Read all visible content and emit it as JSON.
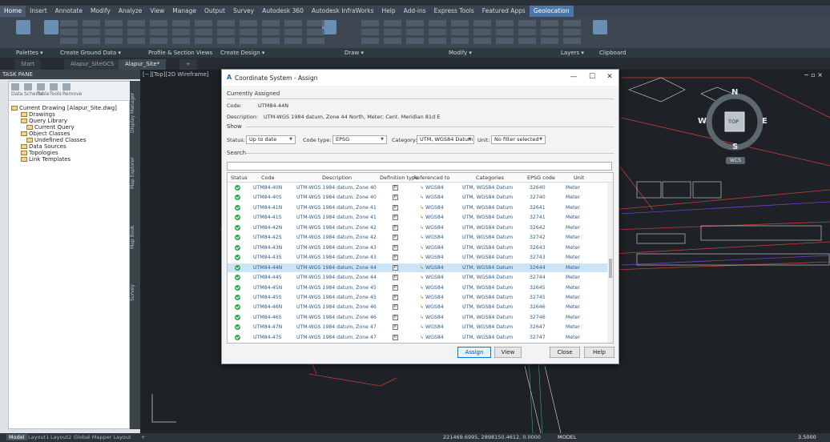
{
  "ribbon": {
    "tabs": [
      "Home",
      "Insert",
      "Annotate",
      "Modify",
      "Analyze",
      "View",
      "Manage",
      "Output",
      "Survey",
      "Autodesk 360",
      "Autodesk InfraWorks",
      "Help",
      "Add-ins",
      "Express Tools",
      "Featured Apps",
      "Geolocation"
    ],
    "active_tab": "Home",
    "panels": [
      "Palettes ▾",
      "Create Ground Data ▾",
      "Profile & Section Views",
      "Create Design ▾",
      "Draw ▾",
      "Modify ▾",
      "Layers ▾",
      "Clipboard"
    ]
  },
  "doc_tabs": [
    "Start",
    "Alapur_SiteGCS",
    "Alapur_Site*"
  ],
  "doc_tab_plus": "+",
  "taskpane": {
    "title": "TASK PANE",
    "tools": [
      "Data",
      "Schema",
      "Table",
      "Tools",
      "Remove"
    ],
    "tree": [
      "Current Drawing [Alapur_Site.dwg]",
      "Drawings",
      "Query Library",
      "Current Query",
      "Object Classes",
      "Undefined Classes",
      "Data Sources",
      "Topologies",
      "Link Templates"
    ],
    "vtabs": [
      "Display Manager",
      "Map Explorer",
      "Map Book",
      "Survey"
    ]
  },
  "drawing": {
    "view_label": "[−][Top][2D Wireframe]",
    "compass": {
      "n": "N",
      "s": "S",
      "e": "E",
      "w": "W",
      "top": "TOP",
      "wcs": "WCS"
    },
    "window_controls": "− ▫ ×"
  },
  "dialog": {
    "title": "Coordinate System - Assign",
    "controls": {
      "minimize": "—",
      "maximize": "☐",
      "close": "✕"
    },
    "currently_assigned_label": "Currently Assigned",
    "code_label": "Code:",
    "code_value": "UTM84-44N",
    "description_label": "Description:",
    "description_value": "UTM-WGS 1984 datum, Zone 44 North, Meter; Cent. Meridian 81d E",
    "show_label": "Show",
    "filters": {
      "status_label": "Status:",
      "status_value": "Up to date",
      "code_type_label": "Code type:",
      "code_type_value": "EPSG",
      "category_label": "Category:",
      "category_value": "UTM, WGS84 Datum",
      "unit_label": "Unit:",
      "unit_value": "No filter selected"
    },
    "search_label": "Search",
    "search_value": "",
    "columns": [
      "Status",
      "Code",
      "Description",
      "Definition type",
      "Referenced to",
      "Categories",
      "EPSG code",
      "Unit"
    ],
    "rows": [
      {
        "code": "UTM84-40N",
        "desc": "UTM-WGS 1984 datum, Zone 40...",
        "ref": "WGS84",
        "cat": "UTM, WGS84 Datum",
        "epsg": "32640",
        "unit": "Meter"
      },
      {
        "code": "UTM84-40S",
        "desc": "UTM-WGS 1984 datum, Zone 40...",
        "ref": "WGS84",
        "cat": "UTM, WGS84 Datum",
        "epsg": "32740",
        "unit": "Meter"
      },
      {
        "code": "UTM84-41N",
        "desc": "UTM-WGS 1984 datum, Zone 41...",
        "ref": "WGS84",
        "cat": "UTM, WGS84 Datum",
        "epsg": "32641",
        "unit": "Meter"
      },
      {
        "code": "UTM84-41S",
        "desc": "UTM-WGS 1984 datum, Zone 41...",
        "ref": "WGS84",
        "cat": "UTM, WGS84 Datum",
        "epsg": "32741",
        "unit": "Meter"
      },
      {
        "code": "UTM84-42N",
        "desc": "UTM-WGS 1984 datum, Zone 42...",
        "ref": "WGS84",
        "cat": "UTM, WGS84 Datum",
        "epsg": "32642",
        "unit": "Meter"
      },
      {
        "code": "UTM84-42S",
        "desc": "UTM-WGS 1984 datum, Zone 42...",
        "ref": "WGS84",
        "cat": "UTM, WGS84 Datum",
        "epsg": "32742",
        "unit": "Meter"
      },
      {
        "code": "UTM84-43N",
        "desc": "UTM-WGS 1984 datum, Zone 43...",
        "ref": "WGS84",
        "cat": "UTM, WGS84 Datum",
        "epsg": "32643",
        "unit": "Meter"
      },
      {
        "code": "UTM84-43S",
        "desc": "UTM-WGS 1984 datum, Zone 43...",
        "ref": "WGS84",
        "cat": "UTM, WGS84 Datum",
        "epsg": "32743",
        "unit": "Meter"
      },
      {
        "code": "UTM84-44N",
        "desc": "UTM-WGS 1984 datum, Zone 44...",
        "ref": "WGS84",
        "cat": "UTM, WGS84 Datum",
        "epsg": "32644",
        "unit": "Meter",
        "selected": true
      },
      {
        "code": "UTM84-44S",
        "desc": "UTM-WGS 1984 datum, Zone 44...",
        "ref": "WGS84",
        "cat": "UTM, WGS84 Datum",
        "epsg": "32744",
        "unit": "Meter"
      },
      {
        "code": "UTM84-45N",
        "desc": "UTM-WGS 1984 datum, Zone 45...",
        "ref": "WGS84",
        "cat": "UTM, WGS84 Datum",
        "epsg": "32645",
        "unit": "Meter"
      },
      {
        "code": "UTM84-45S",
        "desc": "UTM-WGS 1984 datum, Zone 45...",
        "ref": "WGS84",
        "cat": "UTM, WGS84 Datum",
        "epsg": "32745",
        "unit": "Meter"
      },
      {
        "code": "UTM84-46N",
        "desc": "UTM-WGS 1984 datum, Zone 46...",
        "ref": "WGS84",
        "cat": "UTM, WGS84 Datum",
        "epsg": "32646",
        "unit": "Meter"
      },
      {
        "code": "UTM84-46S",
        "desc": "UTM-WGS 1984 datum, Zone 46...",
        "ref": "WGS84",
        "cat": "UTM, WGS84 Datum",
        "epsg": "32746",
        "unit": "Meter"
      },
      {
        "code": "UTM84-47N",
        "desc": "UTM-WGS 1984 datum, Zone 47...",
        "ref": "WGS84",
        "cat": "UTM, WGS84 Datum",
        "epsg": "32647",
        "unit": "Meter"
      },
      {
        "code": "UTM84-47S",
        "desc": "UTM-WGS 1984 datum, Zone 47...",
        "ref": "WGS84",
        "cat": "UTM, WGS84 Datum",
        "epsg": "32747",
        "unit": "Meter"
      }
    ],
    "def_type_glyph": "P",
    "buttons": {
      "assign": "Assign",
      "view": "View",
      "close": "Close",
      "help": "Help"
    }
  },
  "statusbar": {
    "tabs": [
      "Model",
      "Layout1",
      "Layout2",
      "Global Mapper Layout",
      "+"
    ],
    "coords": "221469.6995, 2898150.4612, 0.0000",
    "model": "MODEL",
    "scale": "3.5000"
  },
  "colors": {
    "accent": "#0078d7",
    "ok": "#2fa84f",
    "geo_tab": "#4b78a8",
    "selection": "#cce4f7"
  }
}
